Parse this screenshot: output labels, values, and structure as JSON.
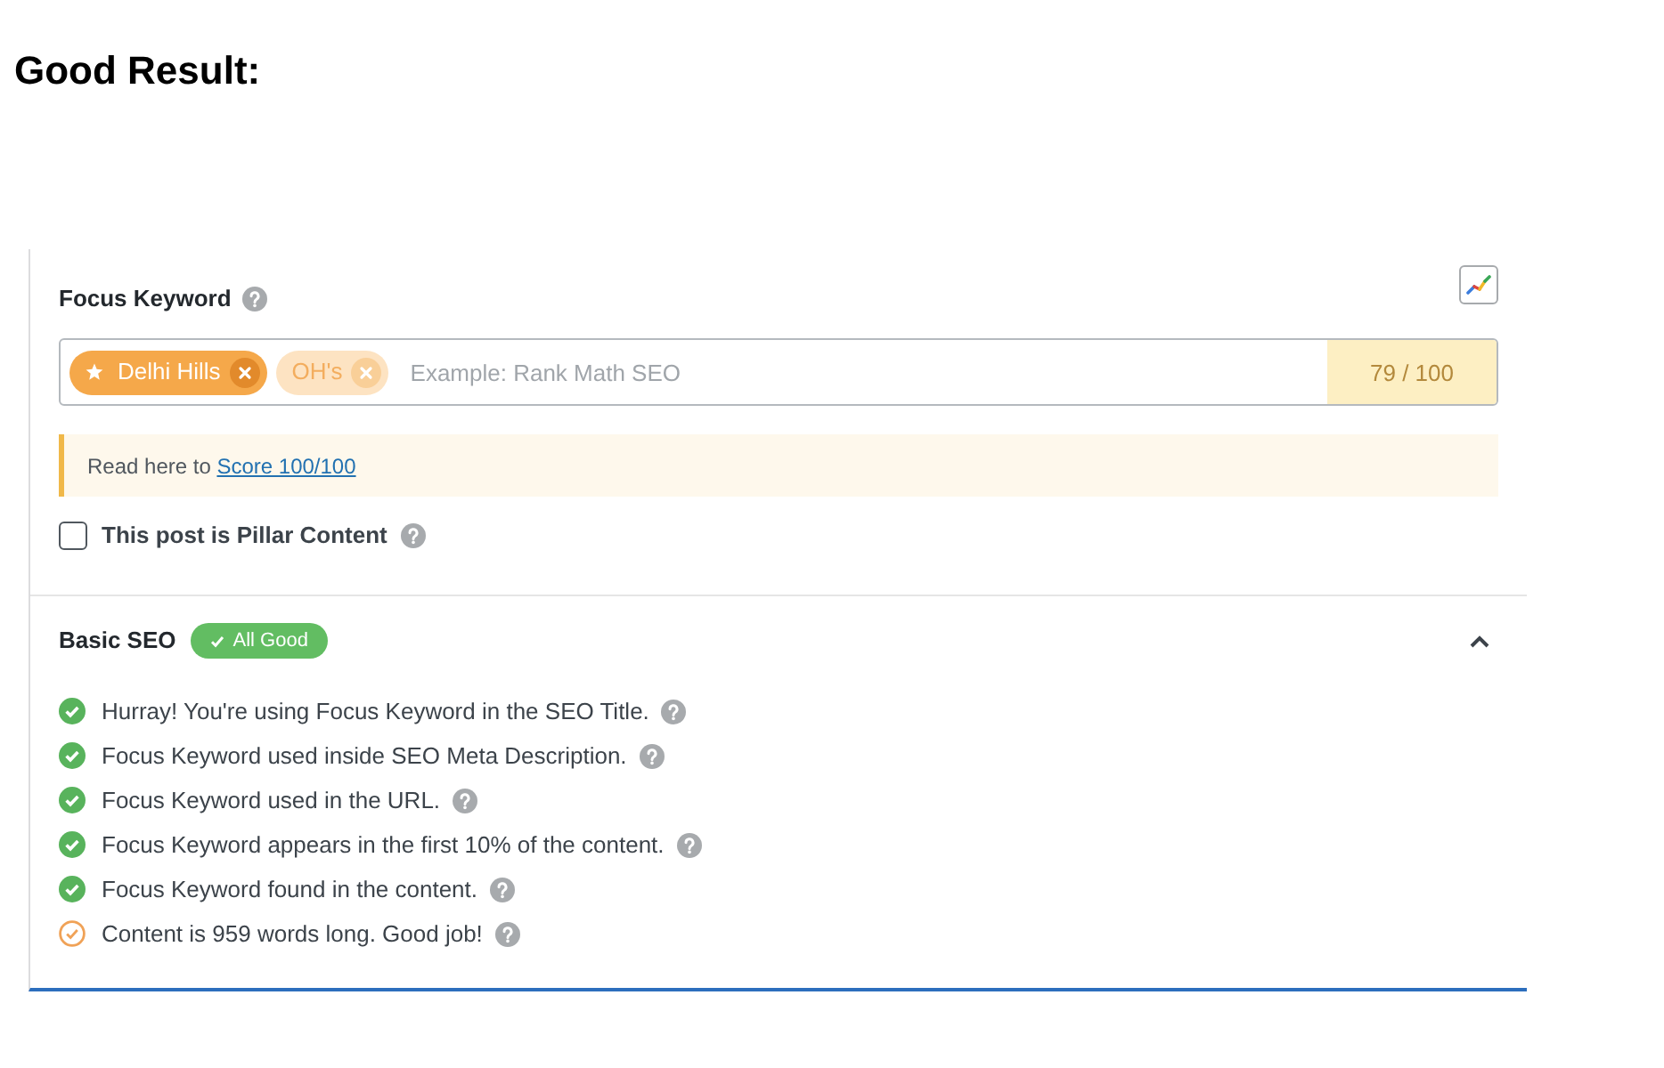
{
  "heading": "Good Result:",
  "focus_keyword": {
    "label": "Focus Keyword",
    "keywords": [
      {
        "text": "Delhi Hills",
        "primary": true
      },
      {
        "text": "OH's",
        "primary": false
      }
    ],
    "placeholder": "Example: Rank Math SEO",
    "score": "79 / 100",
    "notice": {
      "text": "Read here to",
      "link": "Score 100/100"
    },
    "pillar": {
      "label": "This post is Pillar Content",
      "checked": false
    }
  },
  "basic_seo": {
    "title": "Basic SEO",
    "badge": "All Good",
    "expanded": true,
    "checks": [
      {
        "text": "Hurray! You're using Focus Keyword in the SEO Title.",
        "kind": "pass"
      },
      {
        "text": "Focus Keyword used inside SEO Meta Description.",
        "kind": "pass"
      },
      {
        "text": "Focus Keyword used in the URL.",
        "kind": "pass"
      },
      {
        "text": "Focus Keyword appears in the first 10% of the content.",
        "kind": "pass"
      },
      {
        "text": "Focus Keyword found in the content.",
        "kind": "pass"
      },
      {
        "text": "Content is 959 words long. Good job!",
        "kind": "fair"
      }
    ]
  }
}
